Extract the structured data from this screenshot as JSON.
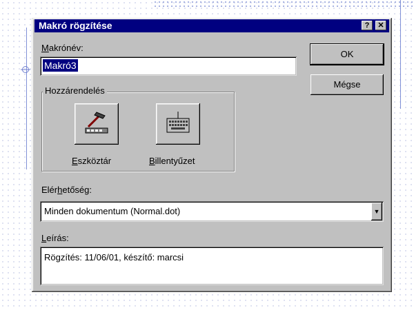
{
  "dialog": {
    "title": "Makró rögzítése",
    "help_button": "?",
    "close_button": "✕"
  },
  "macro_name": {
    "label_first": "M",
    "label_rest": "akrónév:",
    "value": "Makró3"
  },
  "buttons": {
    "ok": "OK",
    "cancel": "Mégse"
  },
  "assign_group": {
    "label": "Hozzárendelés",
    "toolbar_first": "E",
    "toolbar_rest": "szköztár",
    "keyboard_first": "B",
    "keyboard_rest": "illentyűzet",
    "toolbar_icon": "hammer-toolbar-icon",
    "keyboard_icon": "keyboard-icon"
  },
  "availability": {
    "label_pre": "Elér",
    "label_u": "h",
    "label_post": "etőség:",
    "selected": "Minden dokumentum (Normal.dot)",
    "dropdown_icon": "chevron-down-icon"
  },
  "description": {
    "label_first": "L",
    "label_rest": "eírás:",
    "value": "Rögzítés: 11/06/01, készítő: marcsi"
  },
  "colors": {
    "titlebar": "#000080",
    "face": "#c0c0c0",
    "selection": "#000080"
  }
}
